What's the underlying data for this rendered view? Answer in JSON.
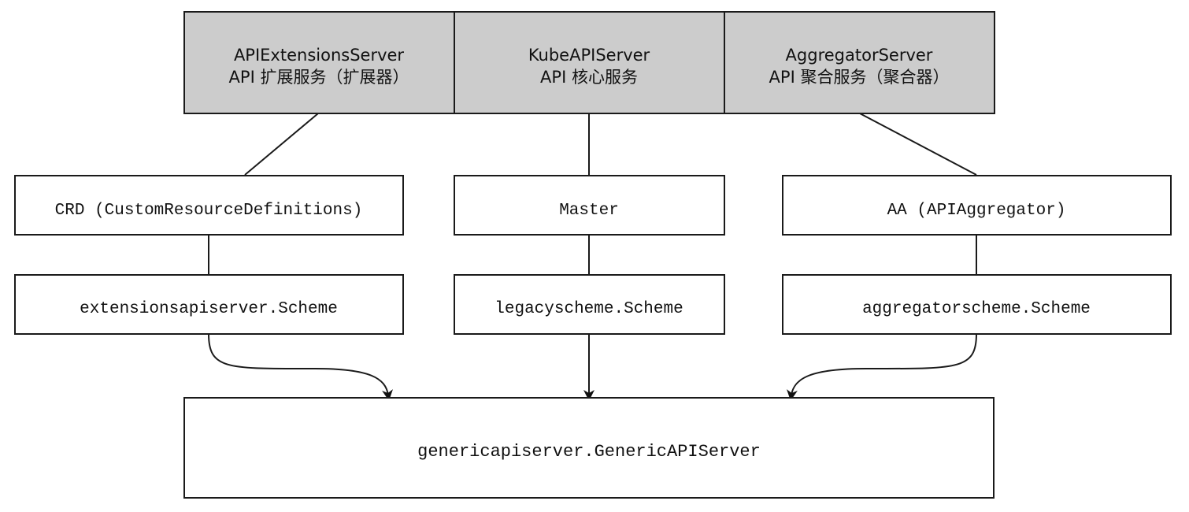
{
  "servers": [
    {
      "name": "APIExtensionsServer",
      "subtitle": "API 扩展服务（扩展器）"
    },
    {
      "name": "KubeAPIServer",
      "subtitle": "API 核心服务"
    },
    {
      "name": "AggregatorServer",
      "subtitle": "API 聚合服务（聚合器）"
    }
  ],
  "components": [
    "CRD (CustomResourceDefinitions)",
    "Master",
    "AA (APIAggregator)"
  ],
  "schemes": [
    "extensionsapiserver.Scheme",
    "legacyscheme.Scheme",
    "aggregatorscheme.Scheme"
  ],
  "generic_server": "genericapiserver.GenericAPIServer"
}
